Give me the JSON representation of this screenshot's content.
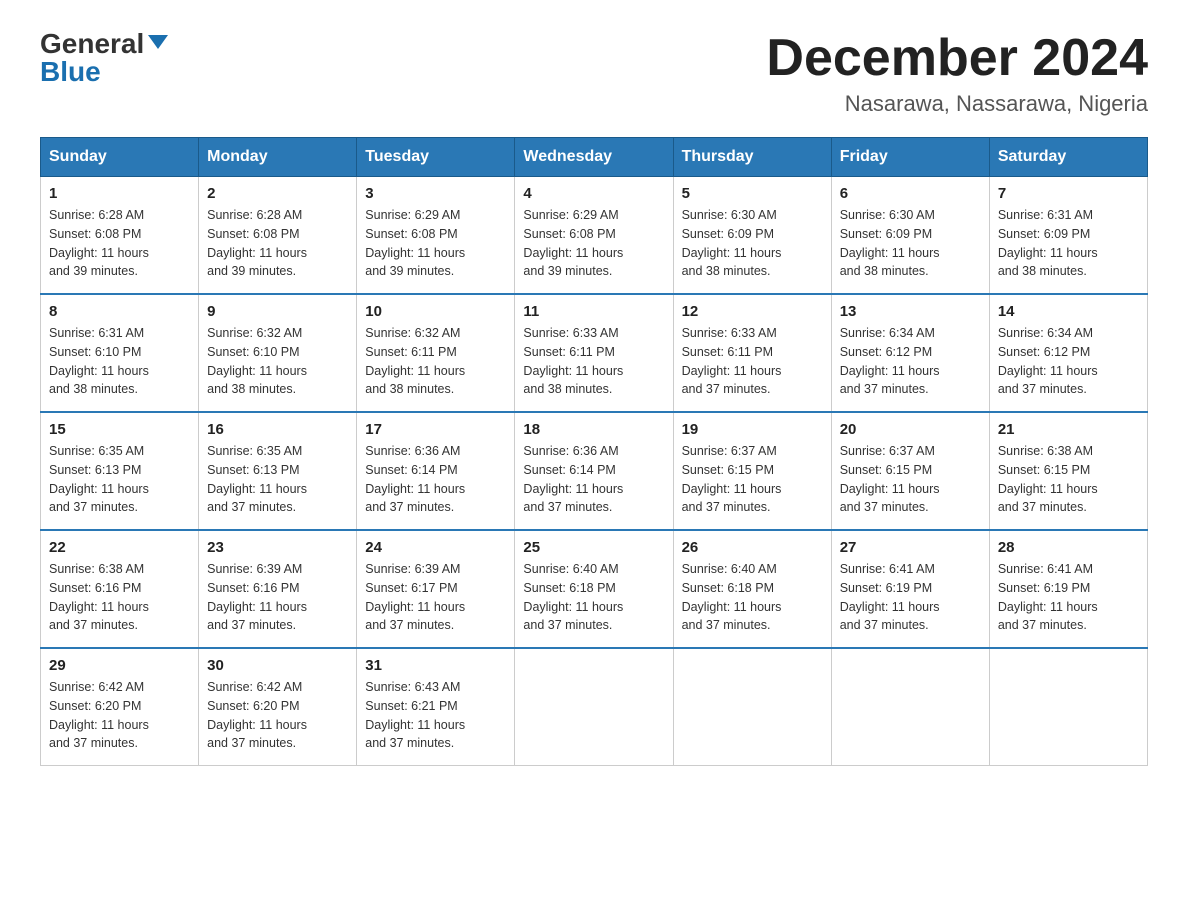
{
  "logo": {
    "general": "General",
    "blue": "Blue"
  },
  "title": "December 2024",
  "location": "Nasarawa, Nassarawa, Nigeria",
  "days_of_week": [
    "Sunday",
    "Monday",
    "Tuesday",
    "Wednesday",
    "Thursday",
    "Friday",
    "Saturday"
  ],
  "weeks": [
    [
      {
        "day": "1",
        "sunrise": "6:28 AM",
        "sunset": "6:08 PM",
        "daylight": "11 hours and 39 minutes."
      },
      {
        "day": "2",
        "sunrise": "6:28 AM",
        "sunset": "6:08 PM",
        "daylight": "11 hours and 39 minutes."
      },
      {
        "day": "3",
        "sunrise": "6:29 AM",
        "sunset": "6:08 PM",
        "daylight": "11 hours and 39 minutes."
      },
      {
        "day": "4",
        "sunrise": "6:29 AM",
        "sunset": "6:08 PM",
        "daylight": "11 hours and 39 minutes."
      },
      {
        "day": "5",
        "sunrise": "6:30 AM",
        "sunset": "6:09 PM",
        "daylight": "11 hours and 38 minutes."
      },
      {
        "day": "6",
        "sunrise": "6:30 AM",
        "sunset": "6:09 PM",
        "daylight": "11 hours and 38 minutes."
      },
      {
        "day": "7",
        "sunrise": "6:31 AM",
        "sunset": "6:09 PM",
        "daylight": "11 hours and 38 minutes."
      }
    ],
    [
      {
        "day": "8",
        "sunrise": "6:31 AM",
        "sunset": "6:10 PM",
        "daylight": "11 hours and 38 minutes."
      },
      {
        "day": "9",
        "sunrise": "6:32 AM",
        "sunset": "6:10 PM",
        "daylight": "11 hours and 38 minutes."
      },
      {
        "day": "10",
        "sunrise": "6:32 AM",
        "sunset": "6:11 PM",
        "daylight": "11 hours and 38 minutes."
      },
      {
        "day": "11",
        "sunrise": "6:33 AM",
        "sunset": "6:11 PM",
        "daylight": "11 hours and 38 minutes."
      },
      {
        "day": "12",
        "sunrise": "6:33 AM",
        "sunset": "6:11 PM",
        "daylight": "11 hours and 37 minutes."
      },
      {
        "day": "13",
        "sunrise": "6:34 AM",
        "sunset": "6:12 PM",
        "daylight": "11 hours and 37 minutes."
      },
      {
        "day": "14",
        "sunrise": "6:34 AM",
        "sunset": "6:12 PM",
        "daylight": "11 hours and 37 minutes."
      }
    ],
    [
      {
        "day": "15",
        "sunrise": "6:35 AM",
        "sunset": "6:13 PM",
        "daylight": "11 hours and 37 minutes."
      },
      {
        "day": "16",
        "sunrise": "6:35 AM",
        "sunset": "6:13 PM",
        "daylight": "11 hours and 37 minutes."
      },
      {
        "day": "17",
        "sunrise": "6:36 AM",
        "sunset": "6:14 PM",
        "daylight": "11 hours and 37 minutes."
      },
      {
        "day": "18",
        "sunrise": "6:36 AM",
        "sunset": "6:14 PM",
        "daylight": "11 hours and 37 minutes."
      },
      {
        "day": "19",
        "sunrise": "6:37 AM",
        "sunset": "6:15 PM",
        "daylight": "11 hours and 37 minutes."
      },
      {
        "day": "20",
        "sunrise": "6:37 AM",
        "sunset": "6:15 PM",
        "daylight": "11 hours and 37 minutes."
      },
      {
        "day": "21",
        "sunrise": "6:38 AM",
        "sunset": "6:15 PM",
        "daylight": "11 hours and 37 minutes."
      }
    ],
    [
      {
        "day": "22",
        "sunrise": "6:38 AM",
        "sunset": "6:16 PM",
        "daylight": "11 hours and 37 minutes."
      },
      {
        "day": "23",
        "sunrise": "6:39 AM",
        "sunset": "6:16 PM",
        "daylight": "11 hours and 37 minutes."
      },
      {
        "day": "24",
        "sunrise": "6:39 AM",
        "sunset": "6:17 PM",
        "daylight": "11 hours and 37 minutes."
      },
      {
        "day": "25",
        "sunrise": "6:40 AM",
        "sunset": "6:18 PM",
        "daylight": "11 hours and 37 minutes."
      },
      {
        "day": "26",
        "sunrise": "6:40 AM",
        "sunset": "6:18 PM",
        "daylight": "11 hours and 37 minutes."
      },
      {
        "day": "27",
        "sunrise": "6:41 AM",
        "sunset": "6:19 PM",
        "daylight": "11 hours and 37 minutes."
      },
      {
        "day": "28",
        "sunrise": "6:41 AM",
        "sunset": "6:19 PM",
        "daylight": "11 hours and 37 minutes."
      }
    ],
    [
      {
        "day": "29",
        "sunrise": "6:42 AM",
        "sunset": "6:20 PM",
        "daylight": "11 hours and 37 minutes."
      },
      {
        "day": "30",
        "sunrise": "6:42 AM",
        "sunset": "6:20 PM",
        "daylight": "11 hours and 37 minutes."
      },
      {
        "day": "31",
        "sunrise": "6:43 AM",
        "sunset": "6:21 PM",
        "daylight": "11 hours and 37 minutes."
      },
      null,
      null,
      null,
      null
    ]
  ],
  "labels": {
    "sunrise": "Sunrise:",
    "sunset": "Sunset:",
    "daylight": "Daylight:"
  }
}
